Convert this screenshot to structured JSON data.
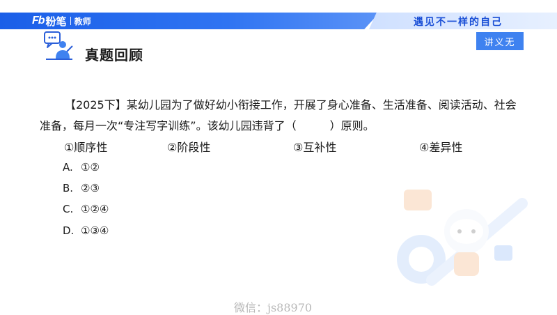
{
  "header": {
    "logo_fb": "Fb",
    "logo_name": "粉笔",
    "logo_sub": "教师",
    "slogan": "遇见不一样的自己"
  },
  "tag": "讲义无",
  "section_title": "真题回顾",
  "question": {
    "line1": "【2025下】某幼儿园为了做好幼小衔接工作，开展了身心准备、生活准备、阅读活动、社会",
    "line2": "准备，每月一次“专注写字训练”。该幼儿园违背了（　　　）原则。",
    "items": [
      "①顺序性",
      "②阶段性",
      "③互补性",
      "④差异性"
    ]
  },
  "choices": [
    {
      "letter": "A.",
      "text": "①②"
    },
    {
      "letter": "B.",
      "text": "②③"
    },
    {
      "letter": "C.",
      "text": "①②④"
    },
    {
      "letter": "D.",
      "text": "①③④"
    }
  ],
  "watermark": "微信：js88970",
  "colors": {
    "brand_blue": "#2f74f2",
    "tag_blue": "#3f82f0",
    "slogan_blue": "#1a4fd6"
  }
}
